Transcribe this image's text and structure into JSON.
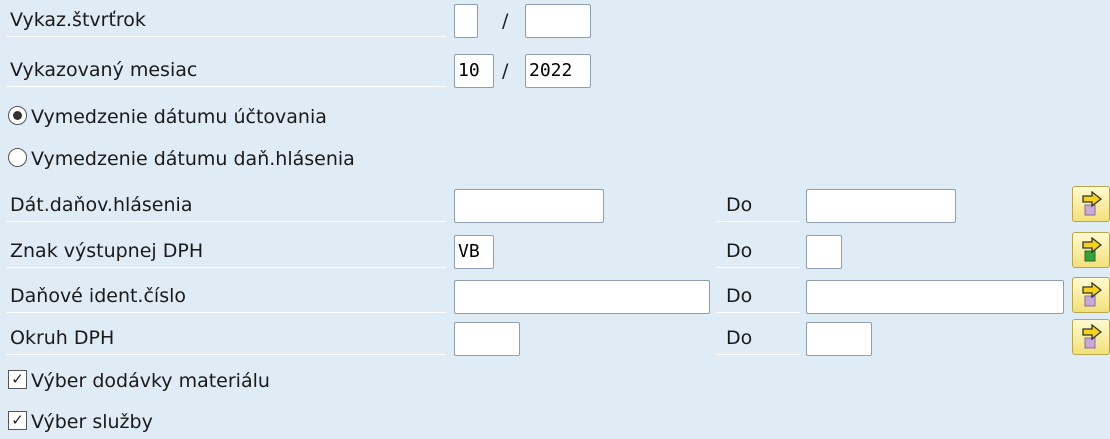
{
  "fields": {
    "quarter": {
      "label": "Vykaz.štvrťrok",
      "value1": "",
      "value2": ""
    },
    "month": {
      "label": "Vykazovaný mesiac",
      "value1": "10",
      "value2": "2022"
    },
    "separator": "/"
  },
  "radios": {
    "posting_date": {
      "label": "Vymedzenie dátumu účtovania",
      "selected": true
    },
    "tax_report_date": {
      "label": "Vymedzenie dátumu daň.hlásenia",
      "selected": false
    }
  },
  "ranges": [
    {
      "label": "Dát.daňov.hlásenia",
      "from": "",
      "to_label": "Do",
      "to": "",
      "arrow_color": "#f6d31b",
      "arrow_icon": "multiple-selection-arrow-icon"
    },
    {
      "label": "Znak výstupnej DPH",
      "from": "VB",
      "to_label": "Do",
      "to": "",
      "arrow_color": "#3aa13a",
      "arrow_icon": "multiple-selection-arrow-icon"
    },
    {
      "label": "Daňové ident.číslo",
      "from": "",
      "to_label": "Do",
      "to": "",
      "arrow_color": "#f6d31b",
      "arrow_icon": "multiple-selection-arrow-icon"
    },
    {
      "label": "Okruh DPH",
      "from": "",
      "to_label": "Do",
      "to": "",
      "arrow_color": "#f6d31b",
      "arrow_icon": "multiple-selection-arrow-icon"
    }
  ],
  "checkboxes": {
    "material_delivery": {
      "label": "Výber dodávky materiálu",
      "checked": true
    },
    "service": {
      "label": "Výber služby",
      "checked": true
    }
  }
}
